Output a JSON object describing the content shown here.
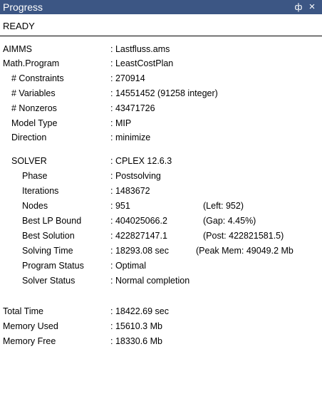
{
  "window": {
    "title": "Progress",
    "pin_glyph": "ф",
    "close_glyph": "×",
    "pin_icon": "pin-icon",
    "close_icon": "close-icon"
  },
  "status": "READY",
  "rows": {
    "aimms": {
      "label": "AIMMS",
      "value": ": Lastfluss.ams"
    },
    "math_program": {
      "label": "Math.Program",
      "value": ": LeastCostPlan"
    },
    "constraints": {
      "label": "# Constraints",
      "value": ": 270914"
    },
    "variables": {
      "label": "# Variables",
      "value": ": 14551452   (91258 integer)"
    },
    "nonzeros": {
      "label": "# Nonzeros",
      "value": ": 43471726"
    },
    "model_type": {
      "label": "Model Type",
      "value": ": MIP"
    },
    "direction": {
      "label": "Direction",
      "value": ": minimize"
    },
    "solver": {
      "label": "SOLVER",
      "value": ": CPLEX 12.6.3"
    },
    "phase": {
      "label": "Phase",
      "value": ": Postsolving"
    },
    "iterations": {
      "label": "Iterations",
      "value": ": 1483672"
    },
    "nodes": {
      "label": "Nodes",
      "value": ": 951",
      "extra": "(Left: 952)"
    },
    "best_lp_bound": {
      "label": "Best LP Bound",
      "value": ": 404025066.2",
      "extra": "(Gap: 4.45%)"
    },
    "best_solution": {
      "label": "Best Solution",
      "value": ": 422827147.1",
      "extra": "(Post: 422821581.5)"
    },
    "solving_time": {
      "label": "Solving Time",
      "value": ": 18293.08 sec",
      "extra": "(Peak Mem: 49049.2 Mb"
    },
    "program_status": {
      "label": "Program Status",
      "value": ": Optimal"
    },
    "solver_status": {
      "label": "Solver Status",
      "value": ": Normal completion"
    },
    "total_time": {
      "label": "Total Time",
      "value": ": 18422.69 sec"
    },
    "memory_used": {
      "label": "Memory Used",
      "value": ": 15610.3 Mb"
    },
    "memory_free": {
      "label": "Memory Free",
      "value": ": 18330.6 Mb"
    }
  }
}
